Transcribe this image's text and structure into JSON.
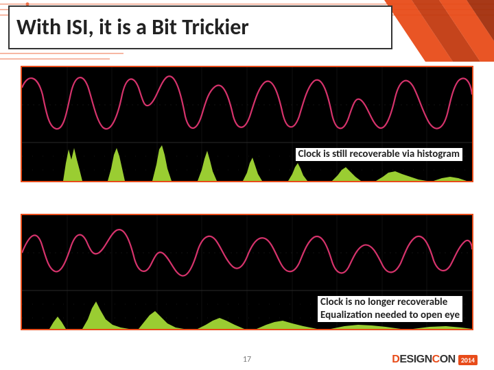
{
  "slide": {
    "title": "With ISI, it is a Bit Trickier",
    "page_number": "17",
    "caption_top": "Clock is still recoverable via histogram",
    "caption_bottom_line1": "Clock is no longer recoverable",
    "caption_bottom_line2": "Equalization needed to open eye"
  },
  "footer": {
    "brand_part1": "D",
    "brand_part2": "ESIGN",
    "brand_part3": "C",
    "brand_part4": "ON",
    "year": "2014"
  },
  "colors": {
    "accent": "#e84c1a",
    "waveform": "#d6336c",
    "histogram": "#9acd32",
    "grid": "#2a2a2a"
  }
}
